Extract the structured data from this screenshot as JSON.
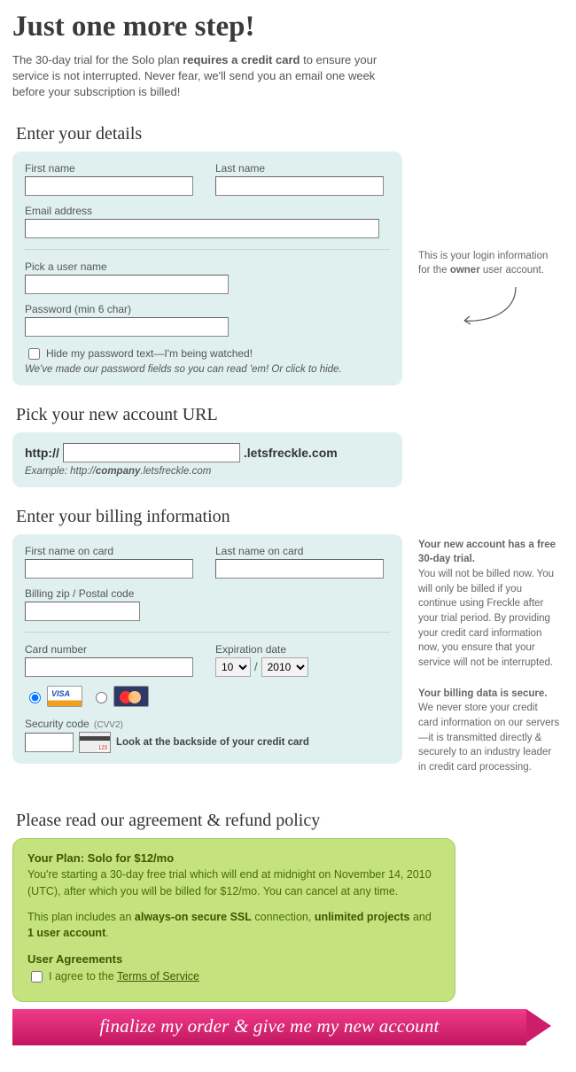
{
  "page": {
    "title": "Just one more step!",
    "intro_prefix": "The 30-day trial for the Solo plan ",
    "intro_bold": "requires a credit card",
    "intro_suffix": " to ensure your service is not interrupted. Never fear, we'll send you an email one week before your subscription is billed!"
  },
  "details": {
    "heading": "Enter your details",
    "first_name_label": "First name",
    "last_name_label": "Last name",
    "email_label": "Email address",
    "username_label": "Pick a user name",
    "password_label": "Password (min 6 char)",
    "hide_pw_label": "Hide my password text—I'm being watched!",
    "pw_hint": "We've made our password fields so you can read 'em! Or click to hide.",
    "sidebar_prefix": "This is your login information for the ",
    "sidebar_bold": "owner",
    "sidebar_suffix": " user account."
  },
  "url": {
    "heading": "Pick your new account URL",
    "prefix": "http://",
    "suffix": ".letsfreckle.com",
    "example_prefix": "Example: http://",
    "example_bold": "company",
    "example_suffix": ".letsfreckle.com"
  },
  "billing": {
    "heading": "Enter your billing information",
    "first_label": "First name on card",
    "last_label": "Last name on card",
    "zip_label": "Billing zip / Postal code",
    "card_label": "Card number",
    "exp_label": "Expiration date",
    "exp_month": "10",
    "exp_year": "2010",
    "security_label_main": "Security code ",
    "security_label_sub": "(CVV2)",
    "cvv_hint": "Look at the backside of your credit card",
    "sidebar1_title": "Your new account has a free 30-day trial.",
    "sidebar1_body": "You will not be billed now. You will only be billed if you continue using Freckle after your trial period. By providing your credit card information now, you ensure that your service will not be interrupted.",
    "sidebar2_title": "Your billing data is secure.",
    "sidebar2_body": "We never store your credit card information on our servers—it is transmitted directly & securely to an industry leader in credit card processing."
  },
  "agreement": {
    "heading": "Please read our agreement & refund policy",
    "plan_line": "Your Plan: Solo for $12/mo",
    "body1": "You're starting a 30-day free trial which will end at midnight on November 14, 2010 (UTC), after which you will be billed for $12/mo. You can cancel at any time.",
    "body2_prefix": "This plan includes an ",
    "body2_b1": "always-on secure SSL",
    "body2_mid1": " connection, ",
    "body2_b2": "unlimited projects",
    "body2_mid2": " and ",
    "body2_b3": "1 user account",
    "body2_suffix": ".",
    "ua_heading": "User Agreements",
    "agree_prefix": "I agree to the ",
    "tos_link": "Terms of Service"
  },
  "finalize_label": "finalize my order & give me my new account"
}
